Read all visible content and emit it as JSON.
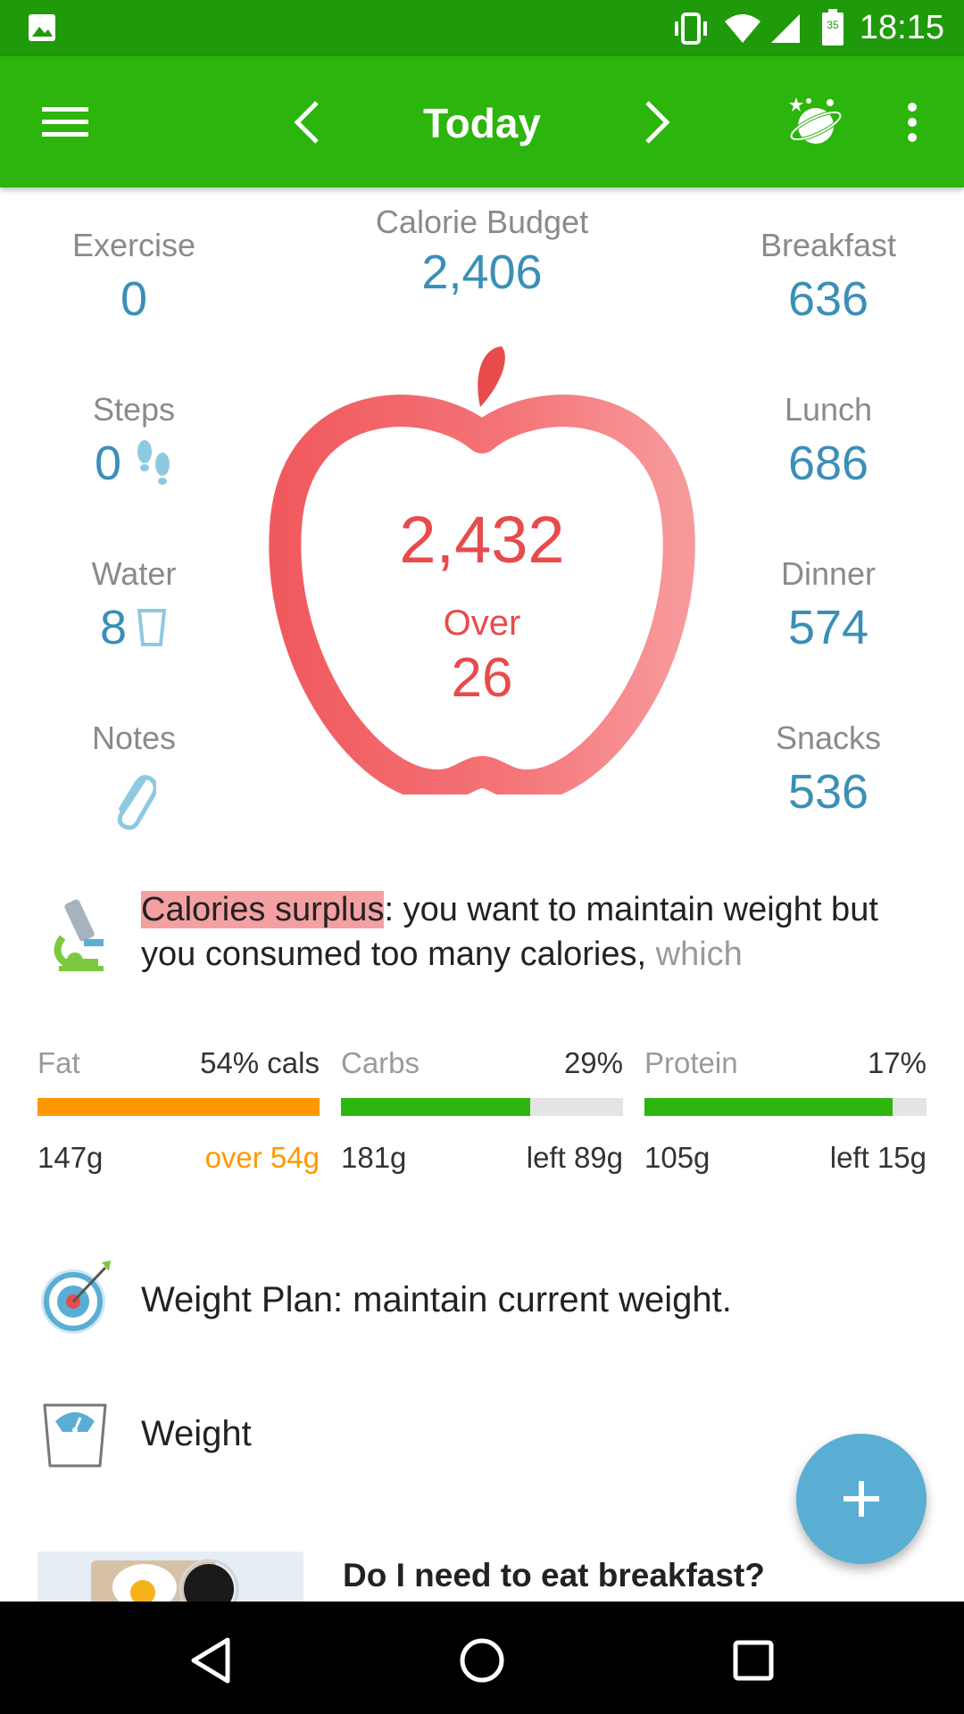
{
  "status_bar": {
    "time": "18:15",
    "battery_level": "35"
  },
  "app_bar": {
    "title": "Today"
  },
  "calorie_budget": {
    "label": "Calorie Budget",
    "value": "2,406"
  },
  "left_stats": {
    "exercise": {
      "label": "Exercise",
      "value": "0"
    },
    "steps": {
      "label": "Steps",
      "value": "0"
    },
    "water": {
      "label": "Water",
      "value": "8"
    },
    "notes": {
      "label": "Notes"
    }
  },
  "meals": {
    "breakfast": {
      "label": "Breakfast",
      "value": "636"
    },
    "lunch": {
      "label": "Lunch",
      "value": "686"
    },
    "dinner": {
      "label": "Dinner",
      "value": "574"
    },
    "snacks": {
      "label": "Snacks",
      "value": "536"
    }
  },
  "apple": {
    "consumed": "2,432",
    "status": "Over",
    "difference": "26"
  },
  "tip": {
    "highlight": "Calories surplus",
    "text": ": you want to maintain weight but you consumed too many calories,",
    "faded": " which"
  },
  "macros": [
    {
      "name": "Fat",
      "percent_label": "54% cals",
      "grams": "147g",
      "remaining": "over 54g",
      "fill_fraction": 1.0,
      "color": "#ff9800",
      "remaining_color": "#ff9800"
    },
    {
      "name": "Carbs",
      "percent_label": "29%",
      "grams": "181g",
      "remaining": "left 89g",
      "fill_fraction": 0.67,
      "color": "#2cb50c",
      "remaining_color": "#333333"
    },
    {
      "name": "Protein",
      "percent_label": "17%",
      "grams": "105g",
      "remaining": "left 15g",
      "fill_fraction": 0.88,
      "color": "#2cb50c",
      "remaining_color": "#333333"
    }
  ],
  "weight_plan": {
    "text": "Weight Plan: maintain current weight."
  },
  "weight": {
    "text": "Weight"
  },
  "article": {
    "title": "Do I need to eat breakfast?"
  },
  "colors": {
    "status_bar": "#1f9a0a",
    "app_bar": "#2cb50c",
    "accent_blue": "#3a8fb7",
    "apple_red": "#e84b4b",
    "fab": "#5aaed4"
  }
}
